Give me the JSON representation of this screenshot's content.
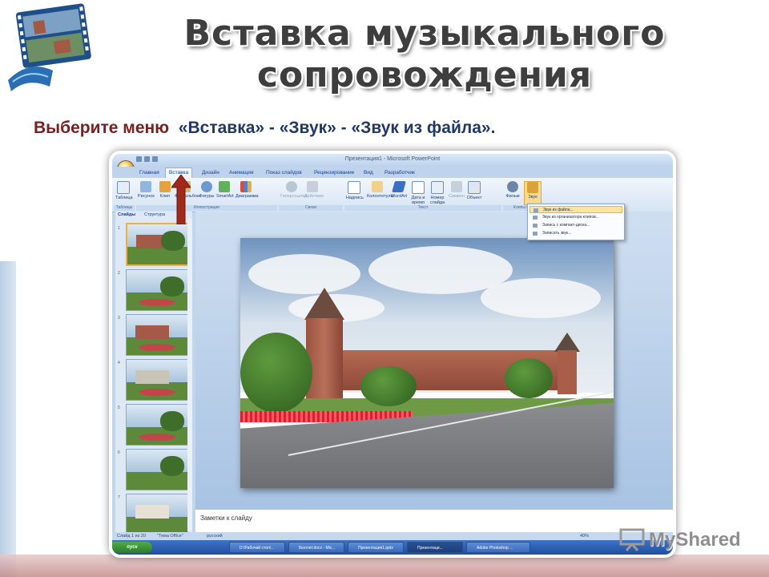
{
  "slide": {
    "title_line1": "Вставка музыкального",
    "title_line2": "сопровождения",
    "instruction_lead": "Выберите меню",
    "instruction_rest": "«Вставка» - «Звук» - «Звук из файла»."
  },
  "ppt": {
    "window_title": "Презентация1 - Microsoft PowerPoint",
    "tabs": [
      "Главная",
      "Вставка",
      "Дизайн",
      "Анимация",
      "Показ слайдов",
      "Рецензирование",
      "Вид",
      "Разработчик"
    ],
    "active_tab": "Вставка",
    "ribbon_buttons": [
      "Таблица",
      "Рисунок",
      "Клип",
      "Фотоальбом",
      "Фигуры",
      "SmartArt",
      "Диаграмма",
      "Гиперссылка",
      "Действие",
      "Надпись",
      "Колонтитулы",
      "WordArt",
      "Дата и время",
      "Номер слайда",
      "Символ",
      "Объект",
      "Фильм",
      "Звук"
    ],
    "ribbon_groups": [
      "Таблицы",
      "Иллюстрации",
      "Связи",
      "Текст",
      "Клипы м..."
    ],
    "pane_tabs": [
      "Слайды",
      "Структура"
    ],
    "slide_numbers": [
      "1",
      "2",
      "3",
      "4",
      "5",
      "6",
      "7"
    ],
    "sound_menu": [
      "Звук из файла...",
      "Звук из организатора клипов...",
      "Запись с компакт-диска...",
      "Записать звук..."
    ],
    "notes_placeholder": "Заметки к слайду",
    "status": {
      "slide_count": "Слайд 1 из 20",
      "theme": "\"Тема Office\"",
      "language": "русский",
      "zoom": "40%"
    },
    "taskbar": {
      "start": "пуск",
      "items": [
        "D:\\Рабочий стол\\...",
        "Бюллет.docx - Mic...",
        "Презентация1.pptx",
        "Презентаци...",
        "Adobe Photoshop ..."
      ]
    }
  },
  "watermark": "MyShared"
}
